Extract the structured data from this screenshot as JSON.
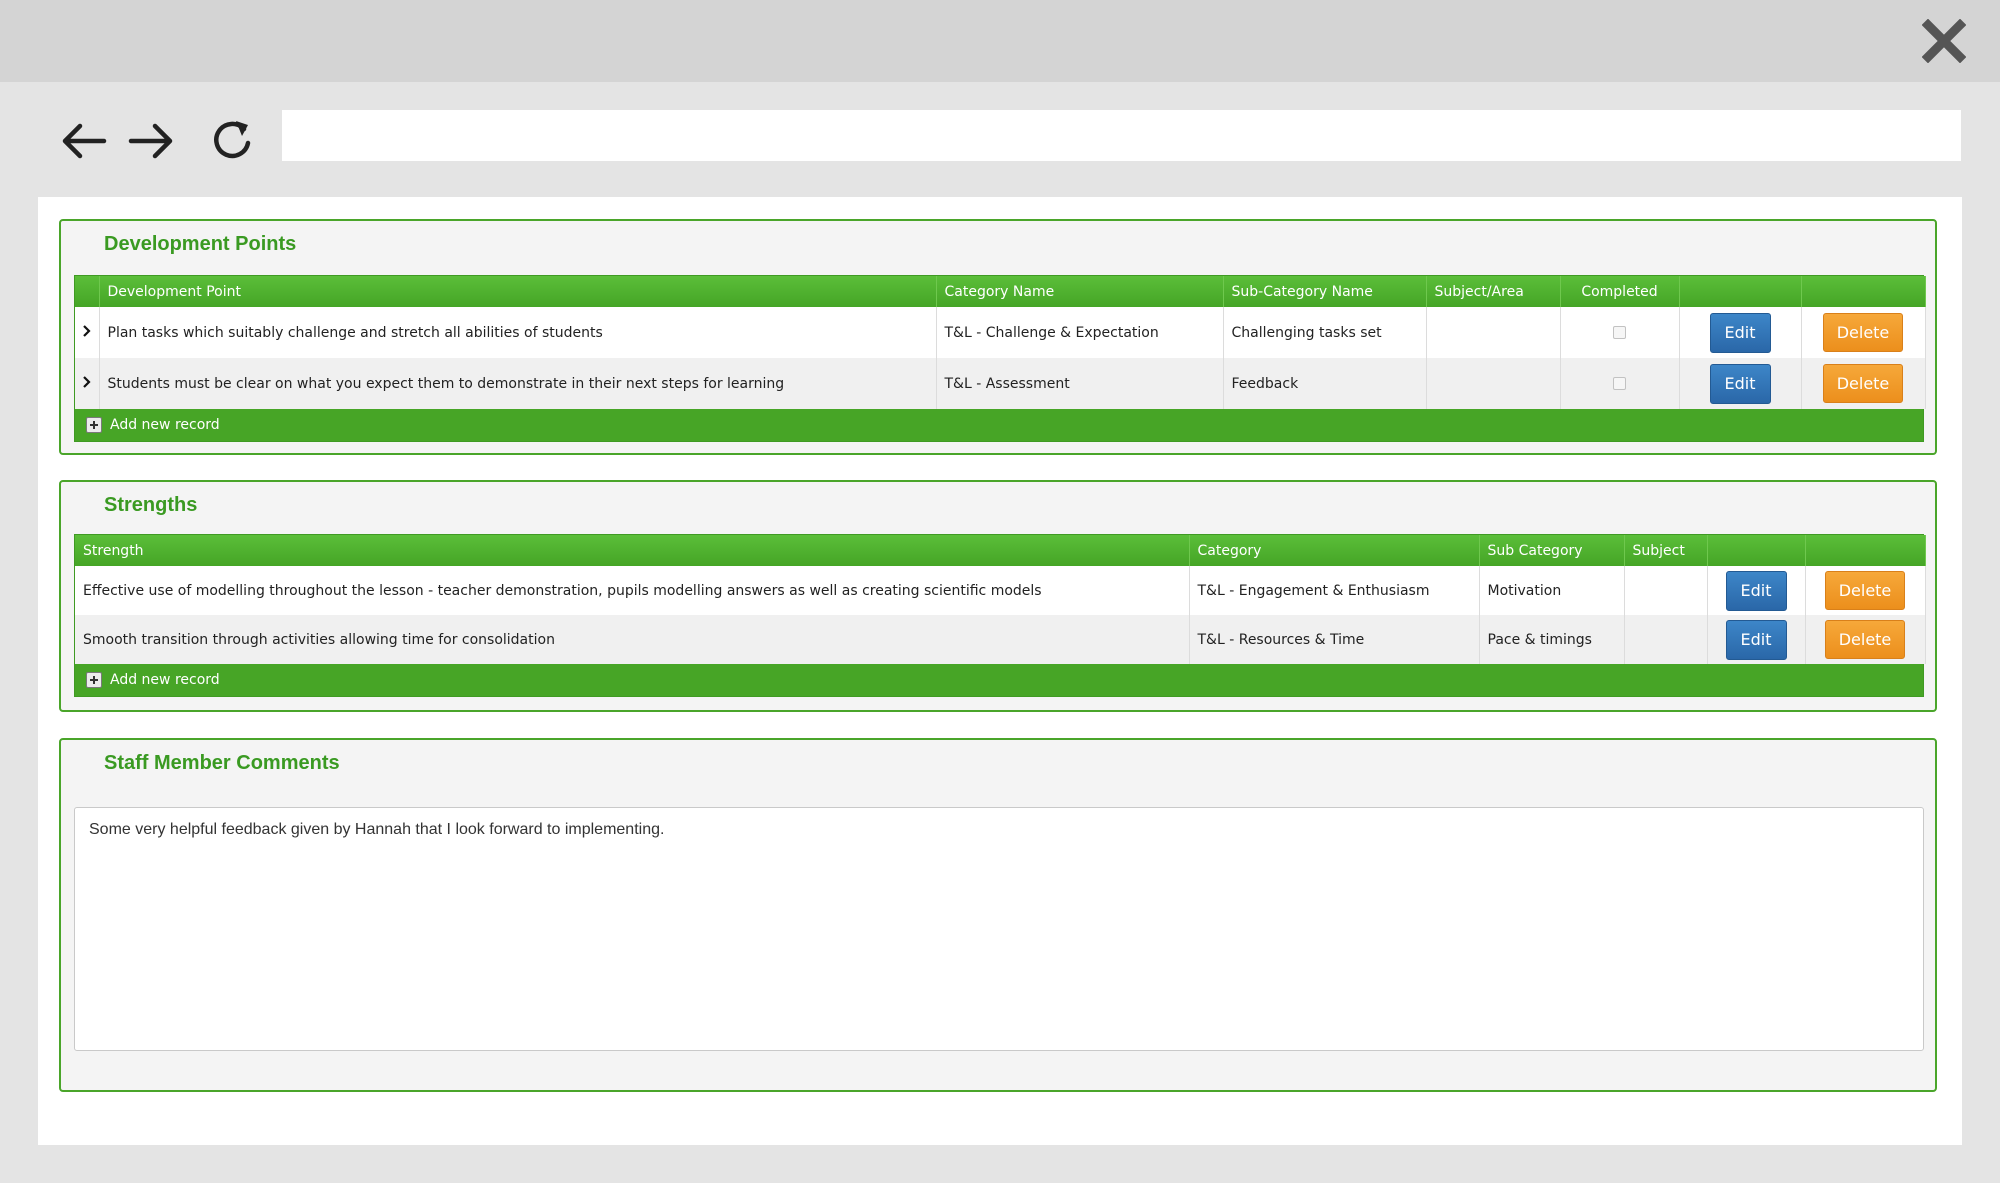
{
  "browser": {
    "url": ""
  },
  "development_points": {
    "title": "Development Points",
    "columns": [
      "Development Point",
      "Category Name",
      "Sub-Category Name",
      "Subject/Area",
      "Completed"
    ],
    "rows": [
      {
        "development_point": "Plan tasks which suitably challenge and stretch all abilities of students",
        "category": "T&L - Challenge & Expectation",
        "sub_category": "Challenging tasks set",
        "subject": "",
        "completed": false,
        "edit_label": "Edit",
        "delete_label": "Delete"
      },
      {
        "development_point": "Students must be clear on what you expect them to demonstrate in their next steps for learning",
        "category": "T&L - Assessment",
        "sub_category": "Feedback",
        "subject": "",
        "completed": false,
        "edit_label": "Edit",
        "delete_label": "Delete"
      }
    ],
    "add_label": "Add new record"
  },
  "strengths": {
    "title": "Strengths",
    "columns": [
      "Strength",
      "Category",
      "Sub Category",
      "Subject"
    ],
    "rows": [
      {
        "strength": "Effective use of modelling throughout the lesson - teacher demonstration, pupils modelling answers as well as creating scientific models",
        "category": "T&L - Engagement & Enthusiasm",
        "sub_category": "Motivation",
        "subject": "",
        "edit_label": "Edit",
        "delete_label": "Delete"
      },
      {
        "strength": "Smooth transition through activities allowing time for consolidation",
        "category": "T&L - Resources & Time",
        "sub_category": "Pace & timings",
        "subject": "",
        "edit_label": "Edit",
        "delete_label": "Delete"
      }
    ],
    "add_label": "Add new record"
  },
  "comments": {
    "title": "Staff Member Comments",
    "text": "Some very helpful feedback given by Hannah that I look forward to implementing."
  },
  "colors": {
    "accent_green": "#45a526",
    "title_green": "#3a9a22",
    "edit_blue": "#2f72b5",
    "delete_orange": "#f09a26"
  },
  "icons": [
    "close-icon",
    "back-arrow-icon",
    "forward-arrow-icon",
    "refresh-icon",
    "chevron-right-icon",
    "plus-icon"
  ]
}
